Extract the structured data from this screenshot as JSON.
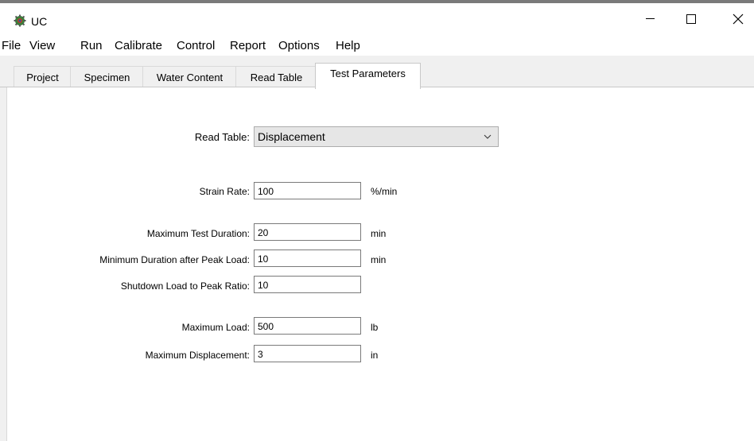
{
  "window": {
    "title": "UC",
    "app_icon": "gear-globe-icon"
  },
  "menu": [
    "File",
    "View",
    "Run",
    "Calibrate",
    "Control",
    "Report",
    "Options",
    "Help"
  ],
  "tabs": [
    "Project",
    "Specimen",
    "Water Content",
    "Read Table",
    "Test Parameters"
  ],
  "active_tab": "Test Parameters",
  "form": {
    "read_table": {
      "label": "Read Table:",
      "value": "Displacement"
    },
    "strain_rate": {
      "label": "Strain Rate:",
      "value": "100",
      "unit": "%/min"
    },
    "max_test_duration": {
      "label": "Maximum Test Duration:",
      "value": "20",
      "unit": "min"
    },
    "min_duration_after_peak": {
      "label": "Minimum Duration after Peak Load:",
      "value": "10",
      "unit": "min"
    },
    "shutdown_ratio": {
      "label": "Shutdown Load to Peak Ratio:",
      "value": "10"
    },
    "max_load": {
      "label": "Maximum Load:",
      "value": "500",
      "unit": "lb"
    },
    "max_displacement": {
      "label": "Maximum Displacement:",
      "value": "3",
      "unit": "in"
    }
  }
}
